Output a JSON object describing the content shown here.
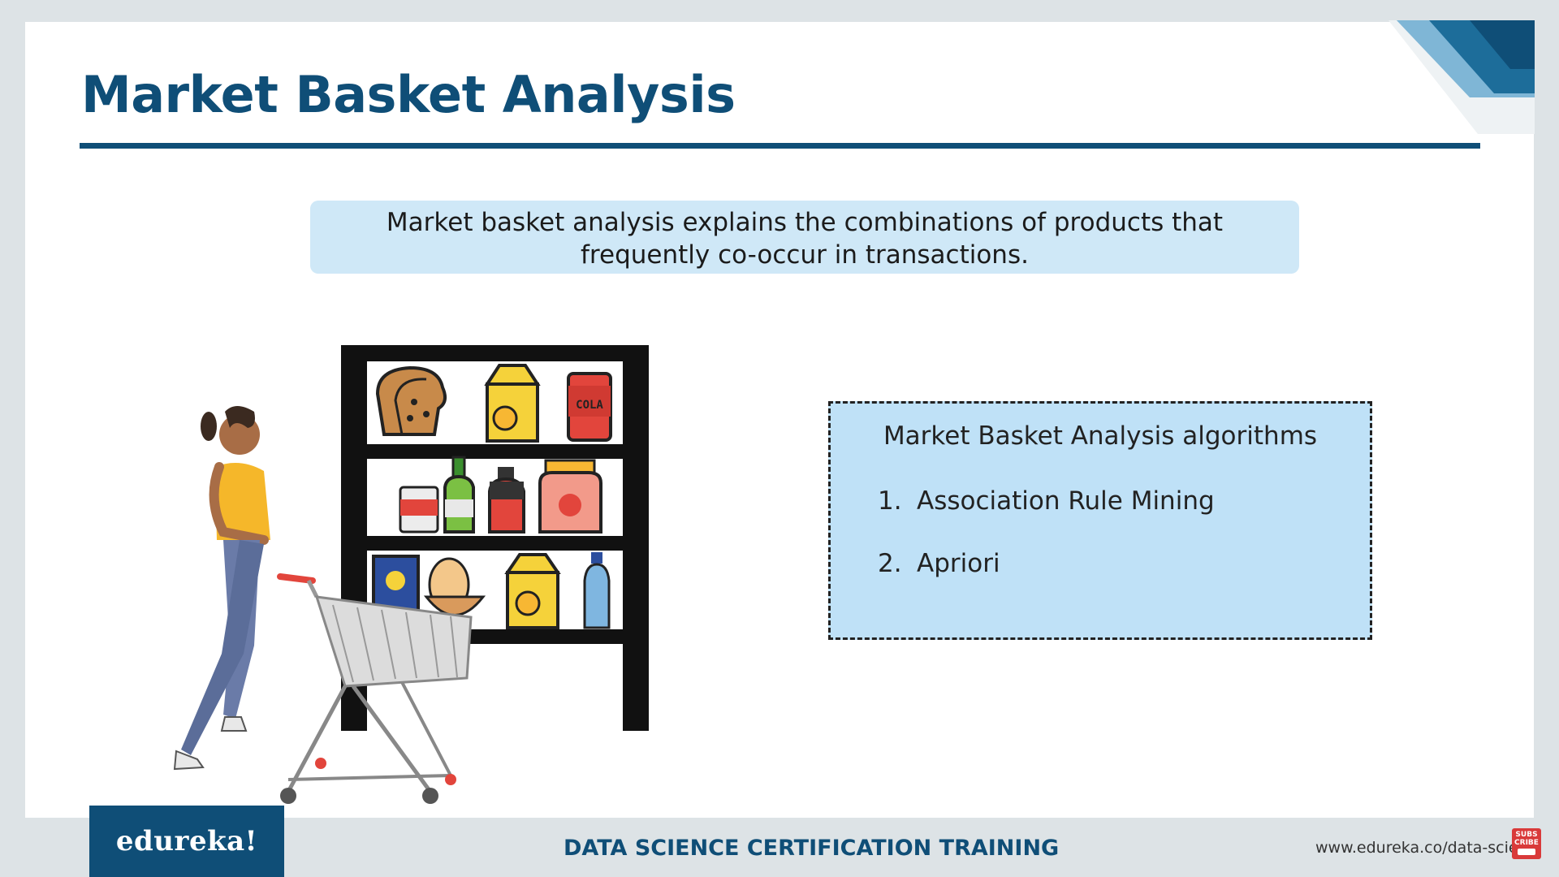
{
  "title": "Market Basket Analysis",
  "definition": "Market basket analysis explains the combinations of products that frequently co-occur in transactions.",
  "algorithms": {
    "heading": "Market Basket Analysis algorithms",
    "items": [
      {
        "number": "1.",
        "label": "Association Rule Mining"
      },
      {
        "number": "2.",
        "label": "Apriori"
      }
    ]
  },
  "illustration": {
    "cola_label": "COLA"
  },
  "footer": {
    "brand": "edureka!",
    "course": "DATA SCIENCE CERTIFICATION TRAINING",
    "url": "www.edureka.co/data-scien",
    "subscribe_badge": "SUBS CRIBE"
  },
  "colors": {
    "brand_blue": "#0f4e77",
    "definition_bg": "#cfe8f7",
    "algo_box_bg": "#bfe1f7",
    "subscribe_red": "#d93a3a"
  }
}
